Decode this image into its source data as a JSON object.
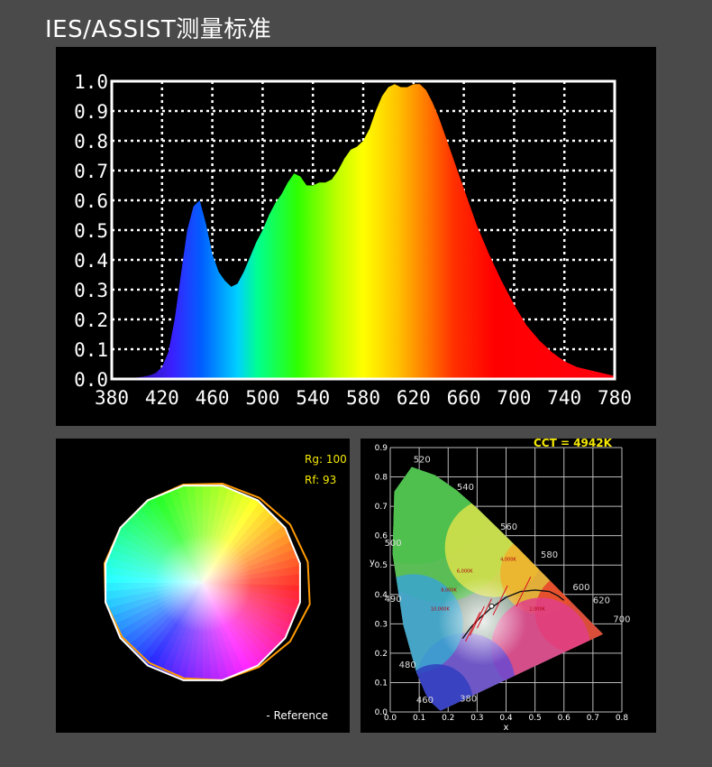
{
  "title": "IES/ASSIST测量标准",
  "chart_data": [
    {
      "type": "area",
      "xlim": [
        380,
        780
      ],
      "ylim": [
        0,
        1.0
      ],
      "grid": true,
      "x_ticks": [
        "380",
        "420",
        "460",
        "500",
        "540",
        "580",
        "620",
        "660",
        "700",
        "740",
        "780"
      ],
      "y_ticks": [
        "0.0",
        "0.1",
        "0.2",
        "0.3",
        "0.4",
        "0.5",
        "0.6",
        "0.7",
        "0.8",
        "0.9",
        "1.0"
      ],
      "x": [
        380,
        390,
        400,
        405,
        410,
        415,
        420,
        425,
        430,
        435,
        440,
        445,
        450,
        455,
        460,
        465,
        470,
        475,
        480,
        485,
        490,
        495,
        500,
        505,
        510,
        515,
        520,
        525,
        530,
        535,
        540,
        545,
        550,
        555,
        560,
        565,
        570,
        575,
        580,
        585,
        590,
        595,
        600,
        605,
        610,
        615,
        620,
        625,
        630,
        635,
        640,
        645,
        650,
        655,
        660,
        665,
        670,
        675,
        680,
        690,
        700,
        710,
        720,
        730,
        740,
        750,
        760,
        770,
        780
      ],
      "values": [
        0,
        0,
        0.005,
        0.008,
        0.012,
        0.02,
        0.04,
        0.09,
        0.2,
        0.35,
        0.5,
        0.58,
        0.6,
        0.52,
        0.42,
        0.36,
        0.33,
        0.31,
        0.32,
        0.36,
        0.41,
        0.46,
        0.5,
        0.55,
        0.59,
        0.62,
        0.66,
        0.69,
        0.68,
        0.65,
        0.65,
        0.66,
        0.66,
        0.67,
        0.7,
        0.74,
        0.77,
        0.78,
        0.8,
        0.84,
        0.9,
        0.95,
        0.98,
        0.99,
        0.98,
        0.98,
        0.99,
        0.99,
        0.97,
        0.93,
        0.88,
        0.82,
        0.76,
        0.7,
        0.64,
        0.58,
        0.52,
        0.47,
        0.42,
        0.33,
        0.25,
        0.18,
        0.13,
        0.09,
        0.06,
        0.04,
        0.03,
        0.02,
        0.01
      ]
    },
    {
      "type": "radar",
      "annotations": [
        "Rg: 100",
        "Rf: 93"
      ],
      "legend": "- Reference"
    },
    {
      "type": "scatter",
      "xlim": [
        0,
        0.8
      ],
      "ylim": [
        0,
        0.9
      ],
      "xlabel": "x",
      "ylabel": "y",
      "grid": true,
      "x_ticks": [
        "0.0",
        "0.1",
        "0.2",
        "0.3",
        "0.4",
        "0.5",
        "0.6",
        "0.7",
        "0.8"
      ],
      "y_ticks": [
        "0.0",
        "0.1",
        "0.2",
        "0.3",
        "0.4",
        "0.5",
        "0.6",
        "0.7",
        "0.8",
        "0.9"
      ],
      "annotations": [
        "CCT = 4942K"
      ],
      "locus_labels": [
        {
          "text": "520",
          "x": 0.08,
          "y": 0.85
        },
        {
          "text": "540",
          "x": 0.23,
          "y": 0.755
        },
        {
          "text": "560",
          "x": 0.38,
          "y": 0.62
        },
        {
          "text": "500",
          "x": -0.02,
          "y": 0.565
        },
        {
          "text": "580",
          "x": 0.52,
          "y": 0.525
        },
        {
          "text": "490",
          "x": -0.02,
          "y": 0.375
        },
        {
          "text": "600",
          "x": 0.63,
          "y": 0.415
        },
        {
          "text": "620",
          "x": 0.7,
          "y": 0.37
        },
        {
          "text": "700",
          "x": 0.77,
          "y": 0.305
        },
        {
          "text": "480",
          "x": 0.03,
          "y": 0.15
        },
        {
          "text": "460",
          "x": 0.09,
          "y": 0.03
        },
        {
          "text": "380",
          "x": 0.24,
          "y": 0.035
        }
      ],
      "cct_labels": [
        "10,000K",
        "8,000K",
        "6,000K",
        "4,000K",
        "2,000K"
      ],
      "point": {
        "x": 0.35,
        "y": 0.36
      }
    }
  ]
}
